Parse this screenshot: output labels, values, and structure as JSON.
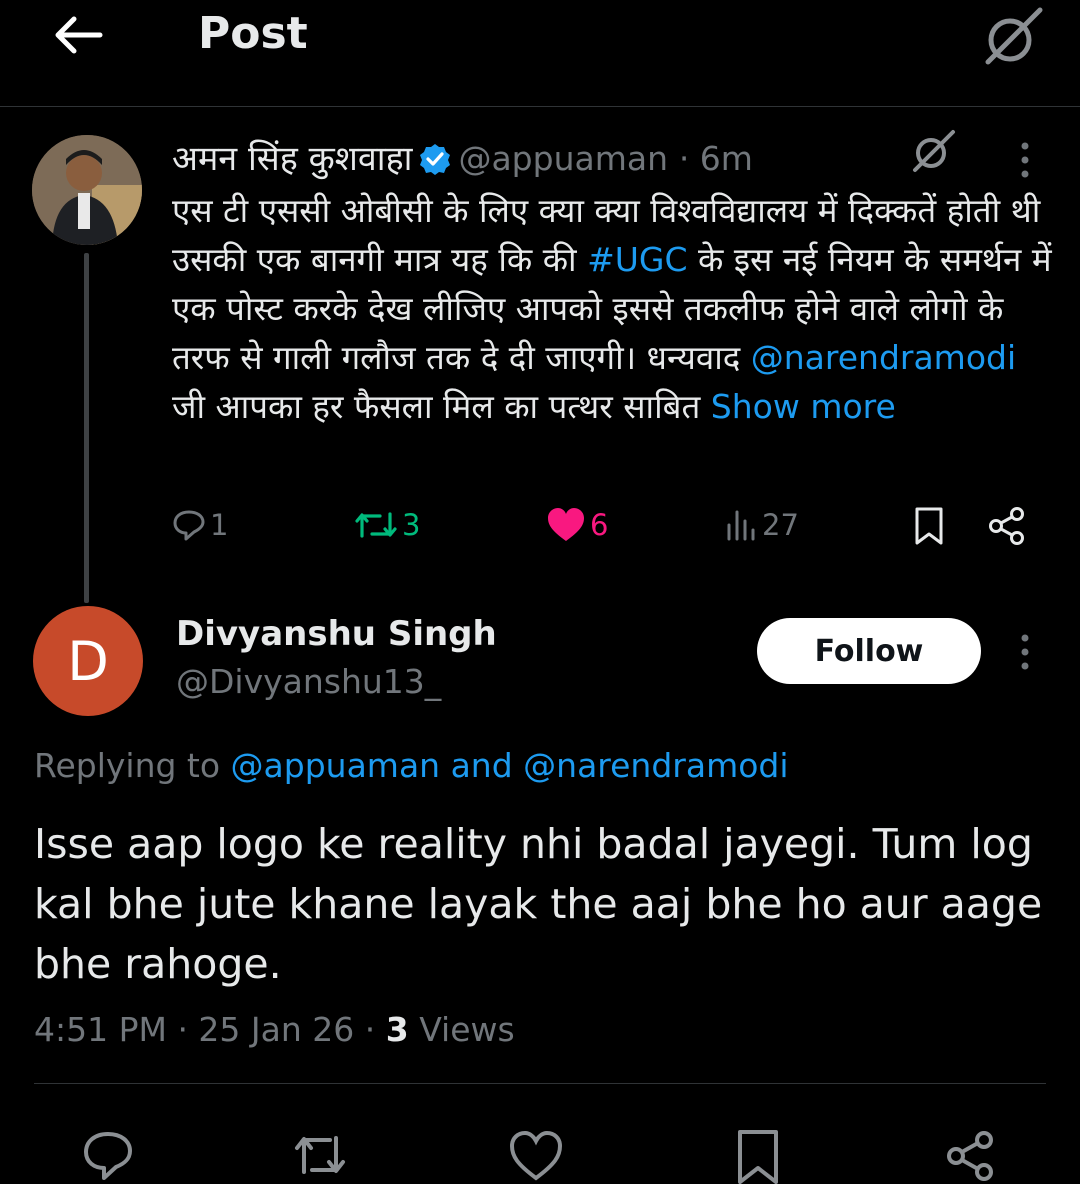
{
  "header": {
    "title": "Post",
    "back_icon": "arrow-left-icon",
    "grok_icon": "grok-icon"
  },
  "parent": {
    "author": "अमन सिंह कुशवाहा",
    "handle": "@appuaman",
    "time": "· 6m",
    "text_before_tag": "एस टी एससी ओबीसी के लिए क्या क्या विश्वविद्यालय में दिक्कतें होती थी उसकी एक बानगी मात्र यह कि की ",
    "hashtag": "#UGC",
    "text_middle": " के इस नई नियम के समर्थन में एक पोस्ट करके देख लीजिए आपको इससे तकलीफ होने वाले लोगो के तरफ से गाली गलौज तक दे दी जाएगी। धन्यवाद ",
    "mention": "@narendramodi",
    "text_after": " जी आपका हर फैसला मिल का पत्थर साबित ",
    "show_more": "Show more",
    "stats": {
      "replies": "1",
      "reposts": "3",
      "likes": "6",
      "views": "27"
    },
    "colors": {
      "repost": "#00ba7c",
      "like": "#f91880",
      "link": "#1d9bf0"
    }
  },
  "reply": {
    "avatar_letter": "D",
    "name": "Divyanshu Singh",
    "handle": "@Divyanshu13_",
    "follow_label": "Follow",
    "replying_prefix": "Replying to ",
    "replying_to": "@appuaman and @narendramodi",
    "text": "Isse aap logo ke reality nhi badal jayegi. Tum log kal bhe jute khane layak the aaj bhe ho aur aage bhe rahoge.",
    "time": "4:51 PM · 25 Jan 26 · ",
    "views_count": "3",
    "views_label": " Views"
  }
}
